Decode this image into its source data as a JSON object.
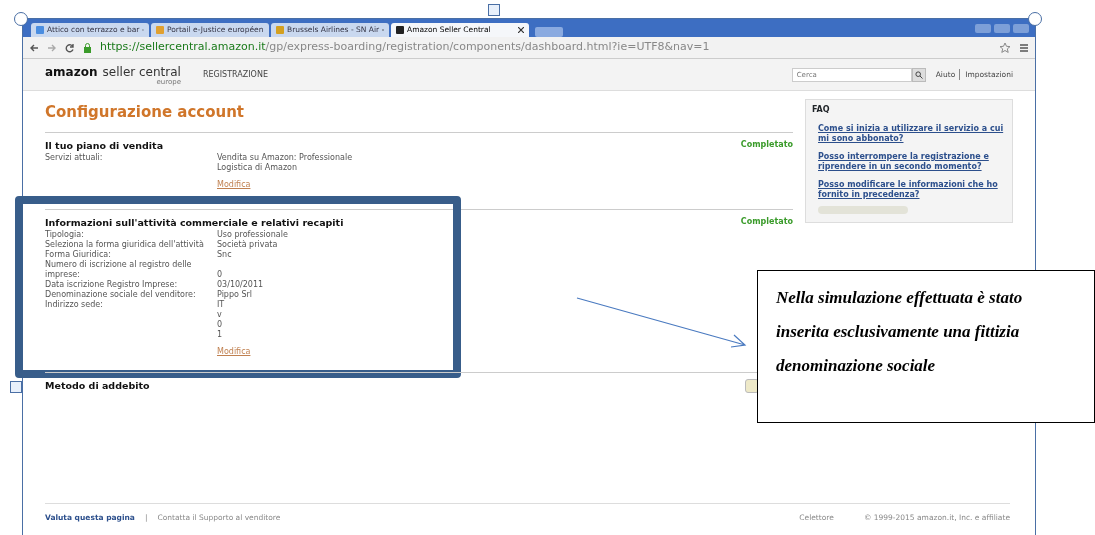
{
  "browser": {
    "tabs": [
      {
        "title": "Attico con terrazzo e bar",
        "selected": false
      },
      {
        "title": "Portail e-Justice européen",
        "selected": false
      },
      {
        "title": "Brussels Airlines - SN Air",
        "selected": false
      },
      {
        "title": "Amazon Seller Central",
        "selected": true
      }
    ],
    "url_host": "https://sellercentral.amazon.it",
    "url_path": "/gp/express-boarding/registration/components/dashboard.html?ie=UTF8&nav=1"
  },
  "header": {
    "logo_brand": "amazon",
    "logo_product": "seller central",
    "logo_region": "europe",
    "nav_item": "REGISTRAZIONE",
    "search_placeholder": "Cerca",
    "links": [
      "Aiuto",
      "Impostazioni"
    ]
  },
  "page_title": "Configurazione account",
  "sections": [
    {
      "title": "Il tuo piano di vendita",
      "status": "Completato",
      "rows": [
        {
          "label": "Servizi attuali:",
          "values": [
            "Vendita su Amazon: Professionale",
            "Logistica di Amazon"
          ]
        }
      ],
      "edit_link": "Modifica"
    },
    {
      "title": "Informazioni sull'attività commerciale e relativi recapiti",
      "status": "Completato",
      "rows": [
        {
          "label": "Tipologia:",
          "values": [
            "Uso professionale"
          ]
        },
        {
          "label": "Seleziona la forma giuridica dell'attività",
          "values": [
            "Società privata"
          ]
        },
        {
          "label": "Forma Giuridica:",
          "values": [
            "Snc"
          ]
        },
        {
          "label": "Numero di iscrizione al registro delle imprese:",
          "values": [
            "0"
          ]
        },
        {
          "label": "Data iscrizione Registro Imprese:",
          "values": [
            "03/10/2011"
          ]
        },
        {
          "label": "Denominazione sociale del venditore:",
          "values": [
            "Pippo Srl"
          ]
        },
        {
          "label": "Indirizzo sede:",
          "values": [
            "IT",
            "v",
            "0",
            "1"
          ]
        }
      ],
      "edit_link": "Modifica",
      "highlighted": true
    },
    {
      "title": "Metodo di addebito"
    }
  ],
  "faq": {
    "title": "FAQ",
    "links": [
      "Come si inizia a utilizzare il servizio a cui mi sono abbonato?",
      "Posso interrompere la registrazione e riprendere in un secondo momento?",
      "Posso modificare le informazioni che ho fornito in precedenza?"
    ]
  },
  "footer": {
    "rate_link": "Valuta questa pagina",
    "separator": "|",
    "support_link": "Contatta il Supporto al venditore",
    "language": "Celettore",
    "copyright": "© 1999-2015 amazon.it, Inc. e affiliate"
  },
  "annotation": {
    "text": "Nella simulazione effettuata è stato inserita esclusivamente una fittizia denominazione sociale"
  }
}
